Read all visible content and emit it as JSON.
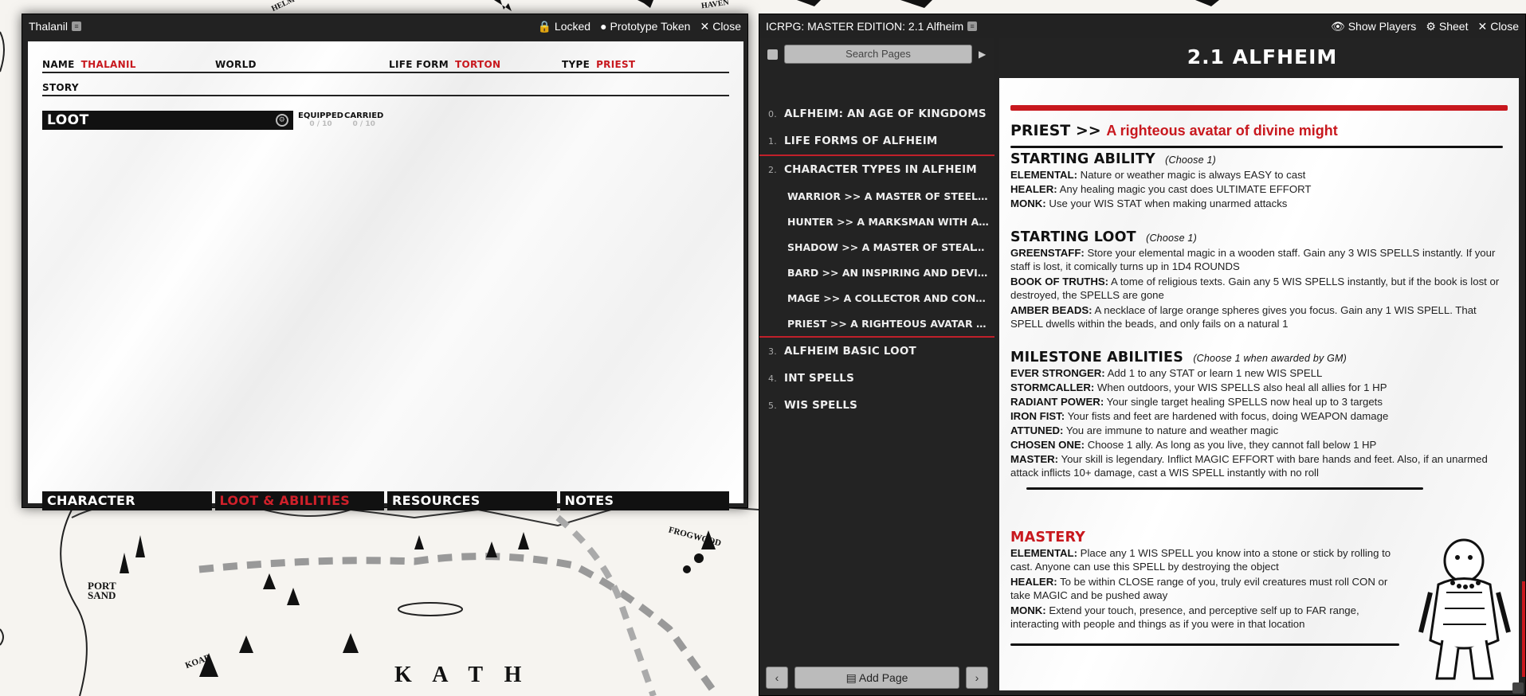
{
  "map": {
    "labels": [
      "PORT SAND",
      "KOAB",
      "K A T H",
      "FROGWOOD",
      "HAVEN",
      "HELM"
    ]
  },
  "sheet_window": {
    "title": "Thalanil",
    "actions": {
      "locked": "Locked",
      "prototype": "Prototype Token",
      "close": "Close"
    },
    "fields": {
      "name_label": "NAME",
      "name_value": "THALANIL",
      "world_label": "WORLD",
      "world_value": "",
      "lifeform_label": "LIFE FORM",
      "lifeform_value": "TORTON",
      "type_label": "TYPE",
      "type_value": "PRIEST",
      "story_label": "STORY"
    },
    "loot": {
      "label": "LOOT",
      "equipped_label": "EQUIPPED",
      "equipped_value": "0 / 10",
      "carried_label": "CARRIED",
      "carried_value": "0 / 10"
    },
    "tabs": [
      "CHARACTER",
      "LOOT & ABILITIES",
      "RESOURCES",
      "NOTES"
    ],
    "active_tab": "LOOT & ABILITIES"
  },
  "journal_window": {
    "title": "ICRPG: MASTER EDITION: 2.1 Alfheim",
    "actions": {
      "show_players": "Show Players",
      "sheet": "Sheet",
      "close": "Close"
    },
    "search_placeholder": "Search Pages",
    "toc": [
      {
        "num": "0.",
        "label": "ALFHEIM: AN AGE OF KINGDOMS"
      },
      {
        "num": "1.",
        "label": "LIFE FORMS OF ALFHEIM"
      },
      {
        "num": "2.",
        "label": "CHARACTER TYPES IN ALFHEIM"
      },
      {
        "num": "3.",
        "label": "ALFHEIM BASIC LOOT"
      },
      {
        "num": "4.",
        "label": "INT SPELLS"
      },
      {
        "num": "5.",
        "label": "WIS SPELLS"
      }
    ],
    "toc_sub": [
      "WARRIOR >> A MASTER OF STEEL W...",
      "HUNTER >> A MARKSMAN WITH A KN...",
      "SHADOW >> A MASTER OF STEALTH A...",
      "BARD >> AN INSPIRING AND DEVIOUS T...",
      "MAGE >> A COLLECTOR AND CONDUIT...",
      "PRIEST >> A RIGHTEOUS AVATAR OF ..."
    ],
    "add_page": "Add Page",
    "page_title": "2.1 ALFHEIM",
    "content": {
      "class_name": "PRIEST >>",
      "class_tagline": "A righteous avatar of divine might",
      "starting_ability": {
        "heading": "STARTING ABILITY",
        "note": "(Choose 1)",
        "items": [
          {
            "k": "ELEMENTAL:",
            "v": "Nature or weather magic is always EASY to cast"
          },
          {
            "k": "HEALER:",
            "v": "Any healing magic you cast does ULTIMATE EFFORT"
          },
          {
            "k": "MONK:",
            "v": "Use your WIS STAT when making unarmed attacks"
          }
        ]
      },
      "starting_loot": {
        "heading": "STARTING LOOT",
        "note": "(Choose 1)",
        "items": [
          {
            "k": "GREENSTAFF:",
            "v": "Store your elemental magic in a wooden staff. Gain any 3 WIS SPELLS instantly. If your staff is lost, it comically turns up in 1D4 ROUNDS"
          },
          {
            "k": "BOOK OF TRUTHS:",
            "v": "A tome of religious texts. Gain any 5 WIS SPELLS instantly, but if the book is lost or destroyed, the SPELLS are gone"
          },
          {
            "k": "AMBER BEADS:",
            "v": "A necklace of large orange spheres gives you focus. Gain any 1 WIS SPELL. That SPELL dwells within the beads, and only fails on a natural 1"
          }
        ]
      },
      "milestone": {
        "heading": "MILESTONE ABILITIES",
        "note": "(Choose 1 when awarded by GM)",
        "items": [
          {
            "k": "EVER STRONGER:",
            "v": "Add 1 to any STAT or learn 1 new WIS SPELL"
          },
          {
            "k": "STORMCALLER:",
            "v": "When outdoors, your WIS SPELLS also heal all allies for 1 HP"
          },
          {
            "k": "RADIANT POWER:",
            "v": "Your single target healing SPELLS now heal up to 3 targets"
          },
          {
            "k": "IRON FIST:",
            "v": "Your fists and feet are hardened with focus, doing WEAPON damage"
          },
          {
            "k": "ATTUNED:",
            "v": "You are immune to nature and weather magic"
          },
          {
            "k": "CHOSEN ONE:",
            "v": "Choose 1 ally. As long as you live, they cannot fall below 1 HP"
          },
          {
            "k": "MASTER:",
            "v": "Your skill is legendary. Inflict MAGIC EFFORT with bare hands and feet. Also, if an unarmed attack inflicts 10+ damage, cast a WIS SPELL instantly with no roll"
          }
        ]
      },
      "mastery": {
        "heading": "MASTERY",
        "items": [
          {
            "k": "ELEMENTAL:",
            "v": "Place any 1 WIS SPELL you know into a stone or stick by rolling to cast. Anyone can use this SPELL by destroying the object"
          },
          {
            "k": "HEALER:",
            "v": "To be within CLOSE range of you, truly evil creatures must roll CON or take MAGIC and be pushed away"
          },
          {
            "k": "MONK:",
            "v": "Extend your touch, presence, and perceptive self up to FAR range, interacting with people and things as if you were in that location"
          }
        ]
      }
    }
  },
  "colors": {
    "accent_red": "#c8181e",
    "window_dark": "#222222"
  }
}
